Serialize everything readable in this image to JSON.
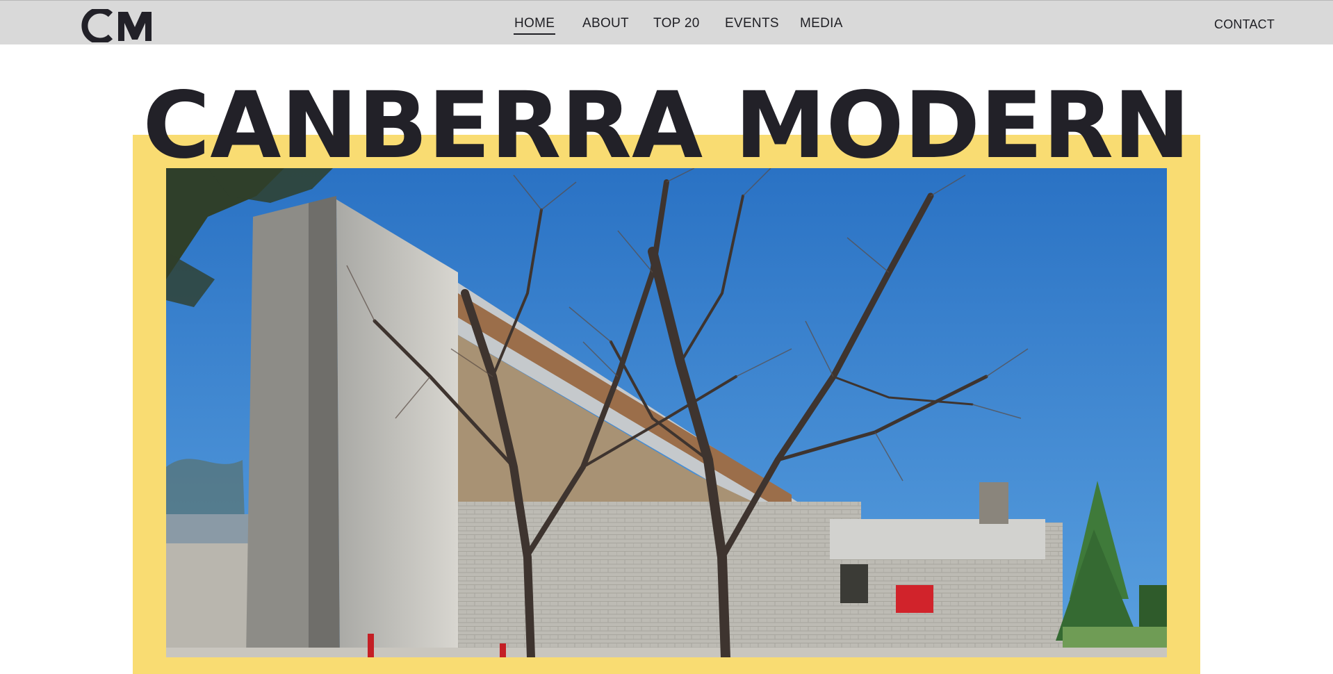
{
  "header": {
    "logo_text": "CM",
    "nav": {
      "home": "HOME",
      "about": "ABOUT",
      "top20": "TOP 20",
      "events": "EVENTS",
      "media": "MEDIA"
    },
    "contact": "CONTACT",
    "active_item": "home"
  },
  "hero": {
    "title": "CANBERRA MODERN",
    "frame_color": "#f9dc72",
    "photo_subject": "modernist concrete building with bare trees under blue sky"
  },
  "colors": {
    "header_bg": "#d9d9d9",
    "text_dark": "#1f1f24",
    "accent_yellow": "#f9dc72"
  }
}
